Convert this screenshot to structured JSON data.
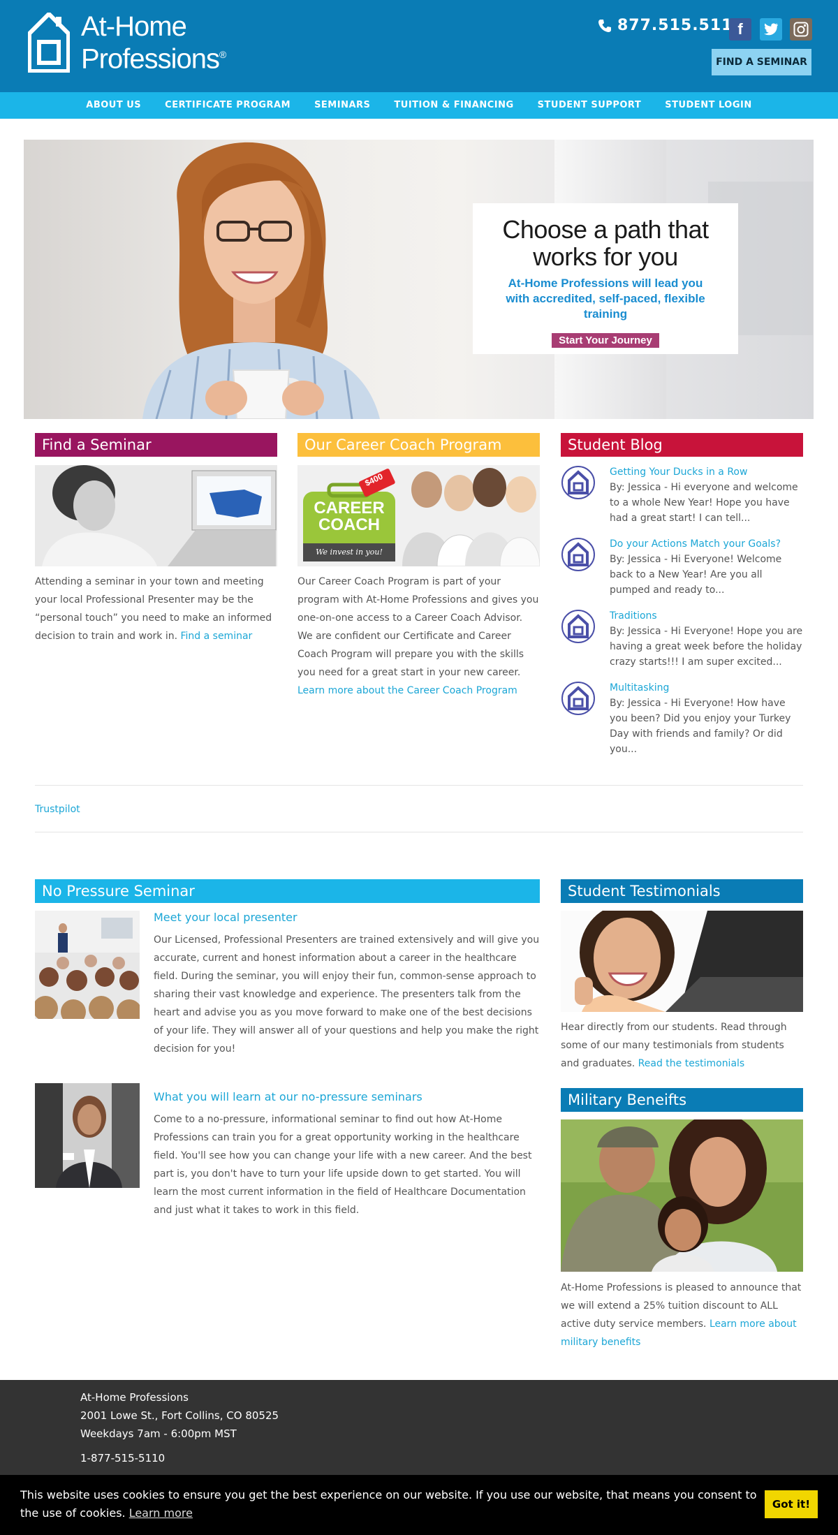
{
  "header": {
    "logo_line1": "At-Home",
    "logo_line2": "Professions",
    "logo_reg": "®",
    "phone": "877.515.5110",
    "find_seminar": "FIND A SEMINAR",
    "colors": {
      "header_bg": "#0a7cb5",
      "nav_bg": "#1bb5e8",
      "find_btn_bg": "#8dd3f2"
    }
  },
  "nav": {
    "items": [
      "ABOUT US",
      "CERTIFICATE PROGRAM",
      "SEMINARS",
      "TUITION & FINANCING",
      "STUDENT SUPPORT",
      "STUDENT LOGIN"
    ]
  },
  "hero": {
    "heading_line1": "Choose a path that",
    "heading_line2": "works for you",
    "subtext": "At-Home Professions will lead you with accredited, self-paced, flexible training",
    "cta": "Start Your Journey"
  },
  "find_seminar": {
    "heading": "Find a Seminar",
    "body": "Attending a seminar in your town and meeting your local Professional Presenter may be the “personal touch” you need to make an informed decision to train and work in. ",
    "link": "Find a seminar"
  },
  "career_coach": {
    "heading": "Our Career Coach Program",
    "badge_line1": "CAREER",
    "badge_line2": "COACH",
    "badge_tagline": "We invest in you!",
    "badge_value": "$400",
    "body": "Our Career Coach Program is part of your program with At-Home Professions and gives you one-on-one access to a Career Coach Advisor. We are confident our Certificate and Career Coach Program will prepare you with the skills you need for a great start in your new career. ",
    "link": "Learn more about the Career Coach Program"
  },
  "blog": {
    "heading": "Student Blog",
    "posts": [
      {
        "title": "Getting Your Ducks in a Row",
        "excerpt": "By: Jessica - Hi everyone and welcome to a whole New Year! Hope you have had a great start! I can tell..."
      },
      {
        "title": "Do your Actions Match your Goals?",
        "excerpt": "By: Jessica - Hi Everyone! Welcome back to a New Year! Are you all pumped and ready to..."
      },
      {
        "title": "Traditions",
        "excerpt": "By: Jessica - Hi Everyone! Hope you are having a great week before the holiday crazy starts!!! I am super excited..."
      },
      {
        "title": "Multitasking",
        "excerpt": "By: Jessica - Hi Everyone! How have you been? Did you enjoy your Turkey Day with friends and family? Or did you..."
      }
    ]
  },
  "trustpilot": "Trustpilot",
  "no_pressure": {
    "heading": "No Pressure Seminar",
    "item1_title": "Meet your local presenter",
    "item1_body": "Our Licensed, Professional Presenters are trained extensively and will give you accurate, current and honest information about a career in the healthcare field. During the seminar, you will enjoy their fun, common-sense approach to sharing their vast knowledge and experience. The presenters talk from the heart and advise you as you move forward to make one of the best decisions of your life. They will answer all of your questions and help you make the right decision for you!",
    "item2_title": "What you will learn at our no-pressure seminars",
    "item2_body": "Come to a no-pressure, informational seminar to find out how At-Home Professions can train you for a great opportunity working in the healthcare field. You'll see how you can change your life with a new career. And the best part is, you don't have to turn your life upside down to get started. You will learn the most current information in the field of Healthcare Documentation and just what it takes to work in this field."
  },
  "testimonials": {
    "heading": "Student Testimonials",
    "body": "Hear directly from our students. Read through some of our many testimonials from students and graduates. ",
    "link": "Read the testimonials"
  },
  "military": {
    "heading": "Military Beneifts",
    "body": "At-Home Professions is pleased to announce that we will extend a 25% tuition discount to ALL active duty service members. ",
    "link": "Learn more about military benefits"
  },
  "footer": {
    "company": "At-Home Professions",
    "address": "2001 Lowe St., Fort Collins, CO 80525",
    "hours": "Weekdays 7am - 6:00pm MST",
    "phone": "1-877-515-5110"
  },
  "cookie": {
    "message": "This website uses cookies to ensure you get the best experience on our website. If you use our website, that means you consent to the use of cookies. ",
    "learn_more": "Learn more",
    "button": "Got it!"
  }
}
